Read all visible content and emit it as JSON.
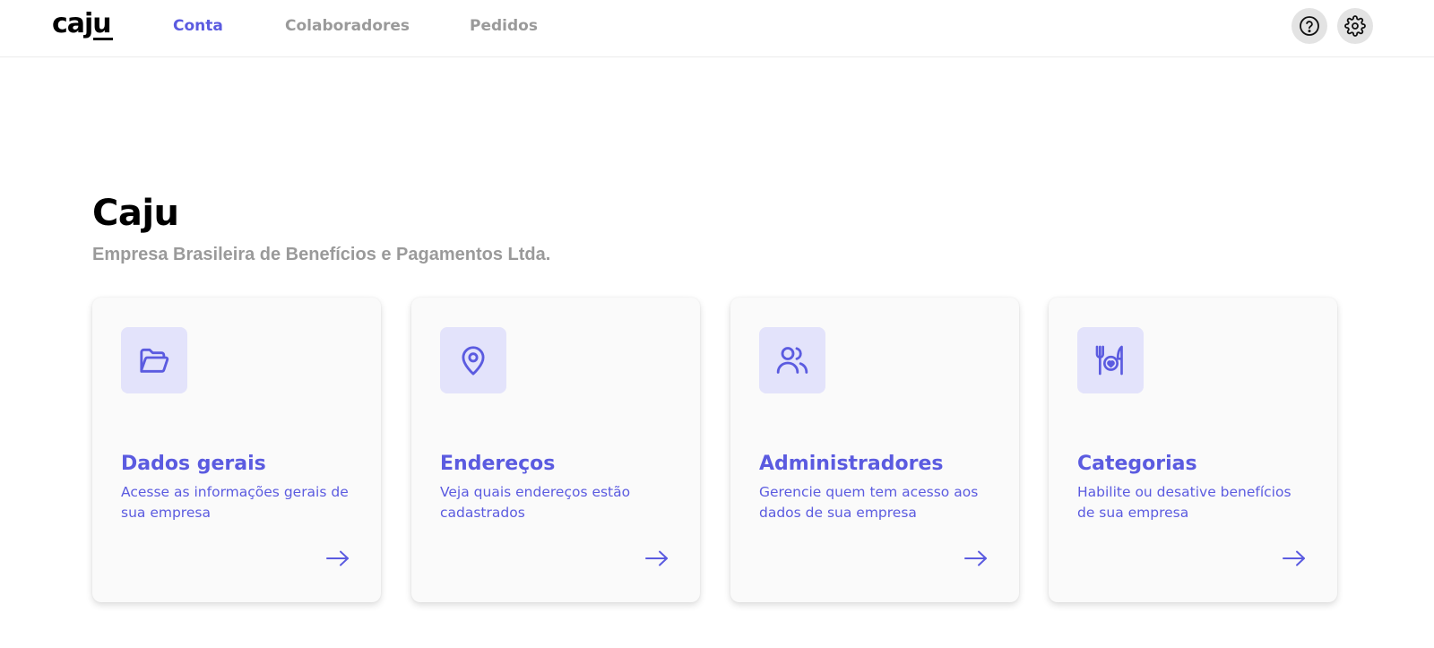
{
  "header": {
    "logo": "caju",
    "tabs": [
      {
        "label": "Conta",
        "active": true
      },
      {
        "label": "Colaboradores",
        "active": false
      },
      {
        "label": "Pedidos",
        "active": false
      }
    ],
    "icons": [
      "help-icon",
      "settings-icon"
    ]
  },
  "page": {
    "title": "Caju",
    "subtitle": "Empresa Brasileira de Benefícios e Pagamentos Ltda."
  },
  "cards": [
    {
      "icon": "folder-open-icon",
      "title": "Dados gerais",
      "description": "Acesse as informações gerais de sua empresa"
    },
    {
      "icon": "map-pin-icon",
      "title": "Endereços",
      "description": "Veja quais endereços estão cadastrados"
    },
    {
      "icon": "users-icon",
      "title": "Administradores",
      "description": "Gerencie quem tem acesso aos dados de sua empresa"
    },
    {
      "icon": "food-benefit-icon",
      "title": "Categorias",
      "description": "Habilite ou desative benefícios de sua empresa"
    }
  ],
  "colors": {
    "accent": "#5b5be0",
    "accent_light": "#e3e3fb",
    "muted_text": "#9a9a9a",
    "card_background": "#fafafa"
  }
}
